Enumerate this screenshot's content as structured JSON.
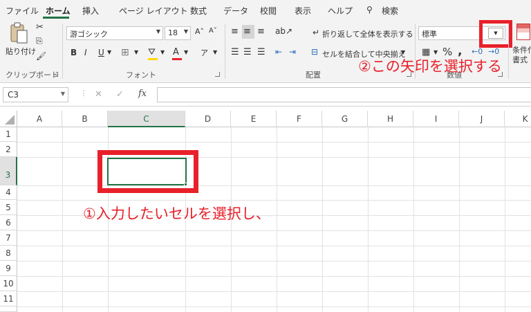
{
  "menu": {
    "items": [
      "ファイル",
      "ホーム",
      "挿入",
      "ページ レイアウト",
      "数式",
      "データ",
      "校閲",
      "表示",
      "ヘルプ",
      "検索"
    ],
    "active": "ホーム"
  },
  "clipboard": {
    "paste_label": "貼り付け",
    "group_label": "クリップボード"
  },
  "font": {
    "font_name": "游ゴシック",
    "font_size": "18",
    "grow_label": "A˄",
    "shrink_label": "A˅",
    "bold": "B",
    "italic": "I",
    "underline": "U",
    "font_color_letter": "A",
    "phonetic_label": "ア",
    "group_label": "フォント"
  },
  "alignment": {
    "wrap_text": "折り返して全体を表示する",
    "merge_center": "セルを結合して中央揃え",
    "group_label": "配置"
  },
  "number": {
    "format": "標準",
    "percent": "%",
    "comma": ",",
    "group_label": "数値"
  },
  "styles": {
    "conditional_label_1": "条件付",
    "conditional_label_2": "書式"
  },
  "formula_bar": {
    "name_box": "C3",
    "fx": "fx",
    "cancel": "✕",
    "enter": "✓"
  },
  "grid": {
    "columns": [
      "A",
      "B",
      "C",
      "D",
      "E",
      "F",
      "G",
      "H",
      "I",
      "J",
      "K"
    ],
    "rows": [
      "1",
      "2",
      "3",
      "4",
      "5",
      "6",
      "7",
      "8",
      "9",
      "10",
      "11"
    ],
    "selected_column": "C",
    "selected_row": "3"
  },
  "annotations": {
    "step1": "①入力したいセルを選択し、",
    "step2": "②この矢印を選択する"
  },
  "colors": {
    "accent": "#217346",
    "annotation": "#e8202a"
  }
}
